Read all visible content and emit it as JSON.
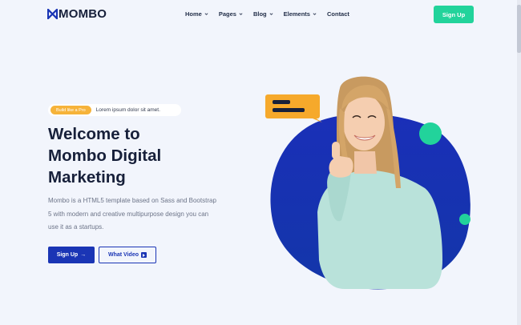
{
  "brand": {
    "name": "MOMBO"
  },
  "nav": {
    "items": [
      {
        "label": "Home",
        "dropdown": true
      },
      {
        "label": "Pages",
        "dropdown": true
      },
      {
        "label": "Blog",
        "dropdown": true
      },
      {
        "label": "Elements",
        "dropdown": true
      },
      {
        "label": "Contact",
        "dropdown": false
      }
    ],
    "cta_label": "Sign Up"
  },
  "hero": {
    "badge": "Build like a Pro",
    "badge_text": "Lorem ipsum dolor sit amet.",
    "title_lines": [
      "Welcome to",
      "Mombo Digital",
      "Marketing"
    ],
    "description": "Mombo is a HTML5 template based on Sass and Bootstrap 5 with modern and creative multipurpose design you can use it as a startups.",
    "primary_button": "Sign Up",
    "secondary_button": "What Video"
  },
  "colors": {
    "brand_blue": "#1a35b5",
    "accent_green": "#22d39b",
    "accent_orange": "#f6b33a",
    "page_bg": "#f2f5fc"
  }
}
